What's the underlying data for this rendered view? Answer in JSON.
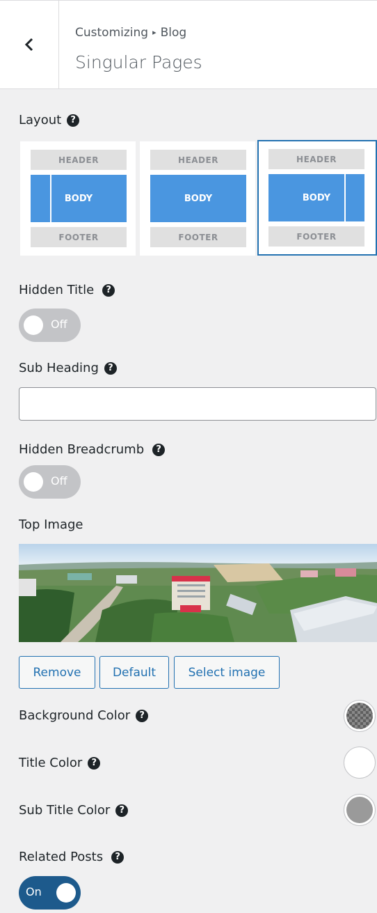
{
  "header": {
    "breadcrumb_root": "Customizing",
    "breadcrumb_sep": "▸",
    "breadcrumb_section": "Blog",
    "title": "Singular Pages"
  },
  "layout": {
    "label": "Layout",
    "help": "?",
    "options": [
      {
        "header": "HEADER",
        "body": "BODY",
        "footer": "FOOTER",
        "sidebar": "left",
        "selected": false
      },
      {
        "header": "HEADER",
        "body": "BODY",
        "footer": "FOOTER",
        "sidebar": "none",
        "selected": false
      },
      {
        "header": "HEADER",
        "body": "BODY",
        "footer": "FOOTER",
        "sidebar": "right",
        "selected": true
      }
    ]
  },
  "hidden_title": {
    "label": "Hidden Title",
    "help": "?",
    "state": "Off"
  },
  "sub_heading": {
    "label": "Sub Heading",
    "help": "?",
    "value": ""
  },
  "hidden_breadcrumb": {
    "label": "Hidden Breadcrumb",
    "help": "?",
    "state": "Off"
  },
  "top_image": {
    "label": "Top Image",
    "buttons": {
      "remove": "Remove",
      "default": "Default",
      "select": "Select image"
    }
  },
  "background_color": {
    "label": "Background Color",
    "help": "?",
    "value": "transparent"
  },
  "title_color": {
    "label": "Title Color",
    "help": "?",
    "value": "#ffffff"
  },
  "sub_title_color": {
    "label": "Sub Title Color",
    "help": "?",
    "value": "#9a9a9a"
  },
  "related_posts": {
    "label": "Related Posts",
    "help": "?",
    "state": "On"
  },
  "colors": {
    "accent": "#2271b1",
    "layout_body": "#4a96e0",
    "toggle_on": "#1d5a8c"
  }
}
